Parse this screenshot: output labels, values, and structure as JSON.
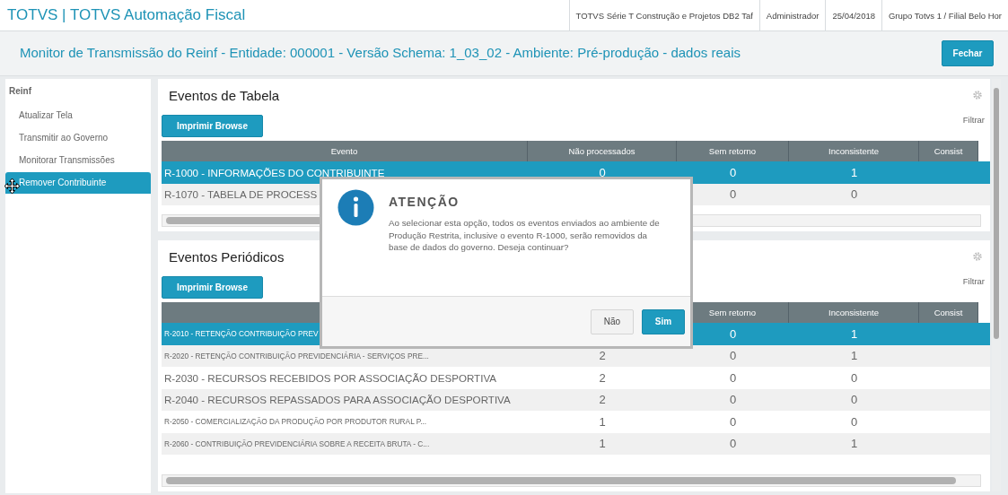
{
  "app_bar": {
    "title": "TOTVS | TOTVS Automação Fiscal",
    "info": [
      "TOTVS Série T Construção e Projetos DB2 Taf",
      "Administrador",
      "25/04/2018",
      "Grupo Totvs 1 / Filial Belo Hor"
    ]
  },
  "page_header": {
    "title": "Monitor de Transmissão do Reinf - Entidade: 000001 - Versão Schema: 1_03_02 - Ambiente: Pré-produção - dados reais",
    "close_button": "Fechar"
  },
  "sidebar": {
    "heading": "Reinf",
    "items": [
      {
        "label": "Atualizar Tela",
        "selected": false
      },
      {
        "label": "Transmitir ao Governo",
        "selected": false
      },
      {
        "label": "Monitorar Transmissões",
        "selected": false
      },
      {
        "label": "Remover Contribuinte",
        "selected": true
      }
    ]
  },
  "panels": [
    {
      "title": "Eventos de Tabela",
      "print_button": "Imprimir Browse",
      "filter": "Filtrar",
      "columns": [
        "Evento",
        "Não processados",
        "Sem retorno",
        "Inconsistente",
        "Consist"
      ],
      "rows": [
        {
          "kind": "large",
          "selected": true,
          "cells": [
            "R-1000 - INFORMAÇÕES DO CONTRIBUINTE",
            "0",
            "0",
            "1"
          ]
        },
        {
          "kind": "large",
          "selected": false,
          "cells": [
            "R-1070 - TABELA DE PROCESS",
            "",
            "0",
            "0"
          ]
        }
      ]
    },
    {
      "title": "Eventos Periódicos",
      "print_button": "Imprimir Browse",
      "filter": "Filtrar",
      "columns": [
        "",
        "",
        "Sem retorno",
        "Inconsistente",
        "Consist"
      ],
      "rows": [
        {
          "kind": "small",
          "selected": true,
          "cells": [
            "R-2010 - RETENÇÃO CONTRIBUIÇÃO PREV",
            "",
            "0",
            "1"
          ]
        },
        {
          "kind": "small",
          "selected": false,
          "cells": [
            "R-2020 - RETENÇÃO CONTRIBUIÇÃO PREVIDENCIÁRIA - SERVIÇOS PRE...",
            "2",
            "0",
            "1"
          ]
        },
        {
          "kind": "large",
          "selected": false,
          "cells": [
            "R-2030 - RECURSOS RECEBIDOS POR ASSOCIAÇÃO DESPORTIVA",
            "2",
            "0",
            "0"
          ]
        },
        {
          "kind": "large",
          "selected": false,
          "cells": [
            "R-2040 - RECURSOS REPASSADOS PARA ASSOCIAÇÃO DESPORTIVA",
            "2",
            "0",
            "0"
          ]
        },
        {
          "kind": "small",
          "selected": false,
          "cells": [
            "R-2050 - COMERCIALIZAÇÃO DA PRODUÇÃO POR PRODUTOR RURAL P...",
            "1",
            "0",
            "0"
          ]
        },
        {
          "kind": "small",
          "selected": false,
          "cells": [
            "R-2060 - CONTRIBUIÇÃO PREVIDENCIÁRIA SOBRE A RECEITA BRUTA - C...",
            "1",
            "0",
            "1"
          ]
        }
      ]
    }
  ],
  "dialog": {
    "title": "ATENÇÃO",
    "message": "Ao selecionar esta opção, todos os eventos enviados ao ambiente de Produção Restrita, inclusive o evento R-1000, serão removidos da base de dados do governo. Deseja continuar?",
    "buttons": [
      {
        "label": "Não",
        "kind": "secondary"
      },
      {
        "label": "Sim",
        "kind": "primary"
      }
    ]
  }
}
